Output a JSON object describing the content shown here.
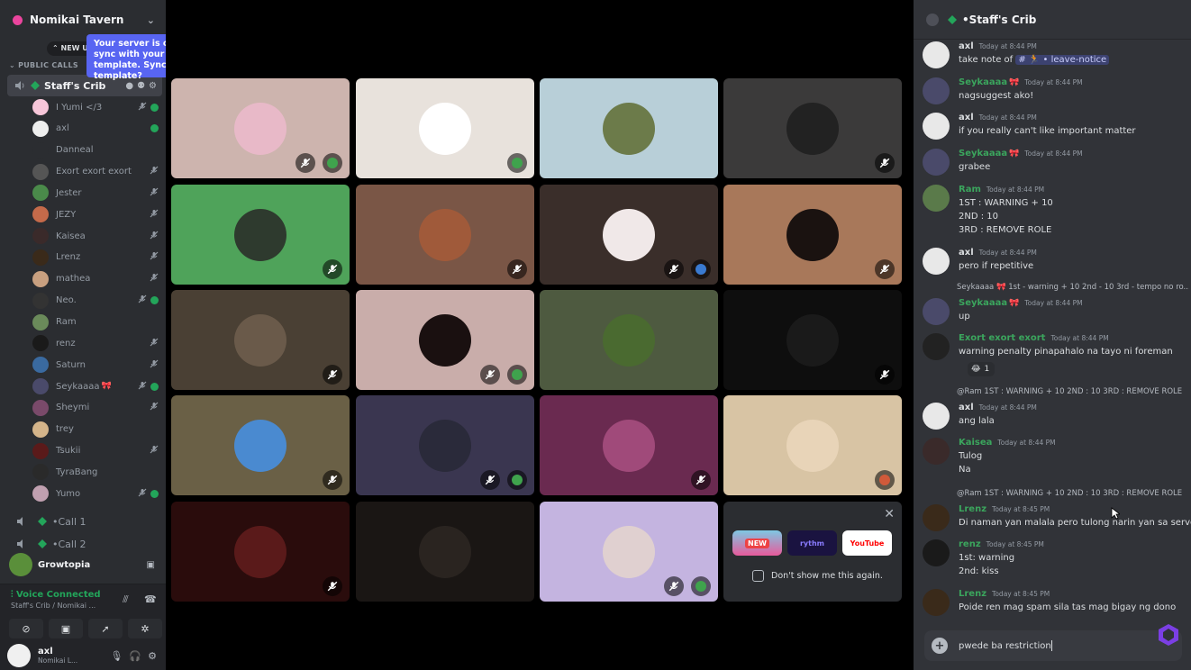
{
  "sidebar": {
    "server_name": "Nomikai Tavern",
    "tooltip": "Your server is out of sync with your server template. Sync template?",
    "new_unreads": "NEW U",
    "section_label": "PUBLIC CALLS",
    "active_channel": "Staff's Crib",
    "members": [
      {
        "name": "I Yumi </3",
        "color": "#f7c6d9"
      },
      {
        "name": "axl",
        "color": "#eeeeee"
      },
      {
        "name": "Danneal",
        "color": "#2b2d31"
      },
      {
        "name": "Exort exort exort",
        "color": "#555555"
      },
      {
        "name": "Jester",
        "color": "#4a8a4a"
      },
      {
        "name": "JEZY",
        "color": "#c46a4a"
      },
      {
        "name": "Kaisea",
        "color": "#3a2a2a"
      },
      {
        "name": "Lrenz",
        "color": "#3a2a1a"
      },
      {
        "name": "mathea",
        "color": "#c8a080"
      },
      {
        "name": "Neo.",
        "color": "#333333"
      },
      {
        "name": "Ram",
        "color": "#6a8a5a"
      },
      {
        "name": "renz",
        "color": "#1a1a1a"
      },
      {
        "name": "Saturn",
        "color": "#3a6aa0"
      },
      {
        "name": "Seykaaaa",
        "color": "#4a4a6a"
      },
      {
        "name": "Sheymi",
        "color": "#7a4a6a"
      },
      {
        "name": "trey",
        "color": "#d4b48a"
      },
      {
        "name": "Tsukii",
        "color": "#5a1a1a"
      },
      {
        "name": "TyraBang",
        "color": "#2a2a2a"
      },
      {
        "name": "Yumo",
        "color": "#c0a0b0"
      }
    ],
    "call1": "Call 1",
    "call2": "Call 2",
    "activity": "Growtopia",
    "voice_connected": "Voice Connected",
    "voice_sub": "Staff's Crib / Nomikai ...",
    "user_name": "axl",
    "user_status": "Nomikai L..."
  },
  "promo": {
    "new_badge": "NEW",
    "rythm": "rythm",
    "youtube": "YouTube",
    "dont_show": "Don't show me this again."
  },
  "chat": {
    "channel": "Staff's Crib",
    "messages": [
      {
        "name": "axl",
        "time": "Today at 8:44 PM",
        "lines": [
          "take note of"
        ],
        "mention": "# 🏃 • leave-notice"
      },
      {
        "name": "Seykaaaa",
        "time": "Today at 8:44 PM",
        "lines": [
          "nagsuggest ako!"
        ]
      },
      {
        "name": "axl",
        "time": "Today at 8:44 PM",
        "lines": [
          "if you really can't like important matter"
        ]
      },
      {
        "name": "Seykaaaa",
        "time": "Today at 8:44 PM",
        "lines": [
          "grabee"
        ]
      },
      {
        "name": "Ram",
        "time": "Today at 8:44 PM",
        "lines": [
          "1ST : WARNING + 10",
          "2ND : 10",
          "3RD : REMOVE ROLE"
        ]
      },
      {
        "name": "axl",
        "time": "Today at 8:44 PM",
        "lines": [
          "pero if repetitive"
        ]
      },
      {
        "reply": "Seykaaaa 🎀 1st - warning + 10 2nd - 10 3rd - tempo no ro...",
        "name": "Seykaaaa",
        "time": "Today at 8:44 PM",
        "lines": [
          "up"
        ]
      },
      {
        "name": "Exort exort exort",
        "time": "Today at 8:44 PM",
        "lines": [
          "warning penalty pinapahalo na tayo ni foreman"
        ],
        "reaction": "1"
      },
      {
        "reply": "@Ram 1ST : WARNING + 10 2ND : 10 3RD : REMOVE ROLE",
        "name": "axl",
        "time": "Today at 8:44 PM",
        "lines": [
          "ang lala"
        ]
      },
      {
        "name": "Kaisea",
        "time": "Today at 8:44 PM",
        "lines": [
          "Tulog",
          "Na"
        ]
      },
      {
        "reply": "@Ram 1ST : WARNING + 10 2ND : 10 3RD : REMOVE ROLE",
        "name": "Lrenz",
        "time": "Today at 8:45 PM",
        "lines": [
          "Di naman yan malala pero tulong narin yan sa server"
        ]
      },
      {
        "name": "renz",
        "time": "Today at 8:45 PM",
        "lines": [
          "1st: warning",
          "2nd: kiss"
        ]
      },
      {
        "name": "Lrenz",
        "time": "Today at 8:45 PM",
        "lines": [
          "Poide ren mag spam sila tas mag bigay ng dono"
        ]
      }
    ],
    "composer_text": "pwede ba restriction"
  },
  "colors": {
    "accent": "#5865f2",
    "green": "#23a55a",
    "name_green": "#3ba55d",
    "name_axl": "#dbdee1"
  }
}
